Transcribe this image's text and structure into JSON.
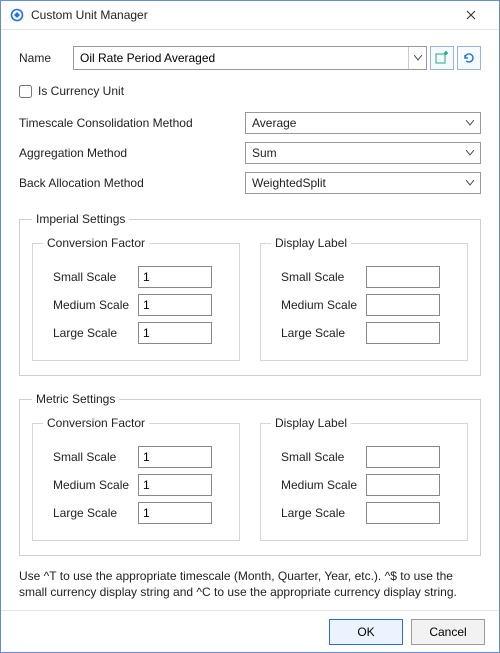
{
  "window": {
    "title": "Custom Unit Manager"
  },
  "name": {
    "label": "Name",
    "value": "Oil Rate Period Averaged"
  },
  "currency": {
    "label": "Is Currency Unit",
    "checked": false
  },
  "methods": {
    "timescale": {
      "label": "Timescale Consolidation Method",
      "value": "Average"
    },
    "aggregation": {
      "label": "Aggregation Method",
      "value": "Sum"
    },
    "backalloc": {
      "label": "Back Allocation Method",
      "value": "WeightedSplit"
    }
  },
  "imperial": {
    "legend": "Imperial Settings",
    "conversion": {
      "legend": "Conversion Factor",
      "small": {
        "label": "Small Scale",
        "value": "1"
      },
      "medium": {
        "label": "Medium Scale",
        "value": "1"
      },
      "large": {
        "label": "Large Scale",
        "value": "1"
      }
    },
    "display": {
      "legend": "Display Label",
      "small": {
        "label": "Small Scale",
        "value": ""
      },
      "medium": {
        "label": "Medium Scale",
        "value": ""
      },
      "large": {
        "label": "Large Scale",
        "value": ""
      }
    }
  },
  "metric": {
    "legend": "Metric Settings",
    "conversion": {
      "legend": "Conversion Factor",
      "small": {
        "label": "Small Scale",
        "value": "1"
      },
      "medium": {
        "label": "Medium Scale",
        "value": "1"
      },
      "large": {
        "label": "Large Scale",
        "value": "1"
      }
    },
    "display": {
      "legend": "Display Label",
      "small": {
        "label": "Small Scale",
        "value": ""
      },
      "medium": {
        "label": "Medium Scale",
        "value": ""
      },
      "large": {
        "label": "Large Scale",
        "value": ""
      }
    }
  },
  "hint": "Use ^T to use the appropriate timescale (Month, Quarter, Year, etc.). ^$ to use the small currency display string and ^C to use the appropriate currency display string.",
  "footer": {
    "ok": "OK",
    "cancel": "Cancel"
  }
}
